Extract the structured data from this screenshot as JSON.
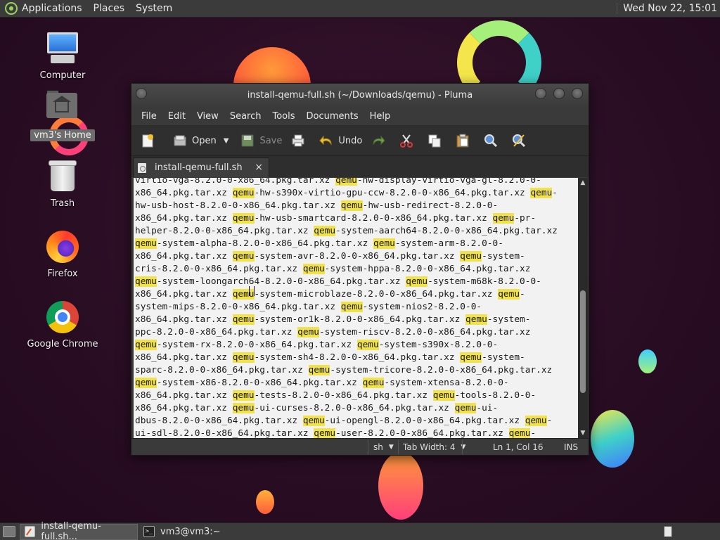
{
  "top_panel": {
    "menus": [
      "Applications",
      "Places",
      "System"
    ],
    "clock": "Wed Nov 22, 15:01"
  },
  "desktop_icons": [
    {
      "label": "Computer"
    },
    {
      "label": "vm3's Home"
    },
    {
      "label": "Trash"
    },
    {
      "label": "Firefox"
    },
    {
      "label": "Google Chrome"
    }
  ],
  "window": {
    "title": "install-qemu-full.sh (~/Downloads/qemu) - Pluma",
    "menus": [
      "File",
      "Edit",
      "View",
      "Search",
      "Tools",
      "Documents",
      "Help"
    ],
    "toolbar": {
      "open": "Open",
      "save": "Save",
      "undo": "Undo"
    },
    "tab": {
      "label": "install-qemu-full.sh",
      "close": "×"
    },
    "editor_lines": [
      [
        "virtio-vga-8.2.0-0-x86_64.pkg.tar.xz ",
        "qemu",
        "-hw-display-virtio-vga-gl-8.2.0-0-"
      ],
      [
        "x86_64.pkg.tar.xz ",
        "qemu",
        "-hw-s390x-virtio-gpu-ccw-8.2.0-0-x86_64.pkg.tar.xz ",
        "qemu",
        "-"
      ],
      [
        "hw-usb-host-8.2.0-0-x86_64.pkg.tar.xz ",
        "qemu",
        "-hw-usb-redirect-8.2.0-0-"
      ],
      [
        "x86_64.pkg.tar.xz ",
        "qemu",
        "-hw-usb-smartcard-8.2.0-0-x86_64.pkg.tar.xz ",
        "qemu",
        "-pr-"
      ],
      [
        "helper-8.2.0-0-x86_64.pkg.tar.xz ",
        "qemu",
        "-system-aarch64-8.2.0-0-x86_64.pkg.tar.xz"
      ],
      [
        "",
        "qemu",
        "-system-alpha-8.2.0-0-x86_64.pkg.tar.xz ",
        "qemu",
        "-system-arm-8.2.0-0-"
      ],
      [
        "x86_64.pkg.tar.xz ",
        "qemu",
        "-system-avr-8.2.0-0-x86_64.pkg.tar.xz ",
        "qemu",
        "-system-"
      ],
      [
        "cris-8.2.0-0-x86_64.pkg.tar.xz ",
        "qemu",
        "-system-hppa-8.2.0-0-x86_64.pkg.tar.xz"
      ],
      [
        "",
        "qemu",
        "-system-loongarch64-8.2.0-0-x86_64.pkg.tar.xz ",
        "qemu",
        "-system-m68k-8.2.0-0-"
      ],
      [
        "x86_64.pkg.tar.xz ",
        "qemu",
        "-system-microblaze-8.2.0-0-x86_64.pkg.tar.xz ",
        "qemu",
        "-"
      ],
      [
        "system-mips-8.2.0-0-x86_64.pkg.tar.xz ",
        "qemu",
        "-system-nios2-8.2.0-0-"
      ],
      [
        "x86_64.pkg.tar.xz ",
        "qemu",
        "-system-or1k-8.2.0-0-x86_64.pkg.tar.xz ",
        "qemu",
        "-system-"
      ],
      [
        "ppc-8.2.0-0-x86_64.pkg.tar.xz ",
        "qemu",
        "-system-riscv-8.2.0-0-x86_64.pkg.tar.xz"
      ],
      [
        "",
        "qemu",
        "-system-rx-8.2.0-0-x86_64.pkg.tar.xz ",
        "qemu",
        "-system-s390x-8.2.0-0-"
      ],
      [
        "x86_64.pkg.tar.xz ",
        "qemu",
        "-system-sh4-8.2.0-0-x86_64.pkg.tar.xz ",
        "qemu",
        "-system-"
      ],
      [
        "sparc-8.2.0-0-x86_64.pkg.tar.xz ",
        "qemu",
        "-system-tricore-8.2.0-0-x86_64.pkg.tar.xz"
      ],
      [
        "",
        "qemu",
        "-system-x86-8.2.0-0-x86_64.pkg.tar.xz ",
        "qemu",
        "-system-xtensa-8.2.0-0-"
      ],
      [
        "x86_64.pkg.tar.xz ",
        "qemu",
        "-tests-8.2.0-0-x86_64.pkg.tar.xz ",
        "qemu",
        "-tools-8.2.0-0-"
      ],
      [
        "x86_64.pkg.tar.xz ",
        "qemu",
        "-ui-curses-8.2.0-0-x86_64.pkg.tar.xz ",
        "qemu",
        "-ui-"
      ],
      [
        "dbus-8.2.0-0-x86_64.pkg.tar.xz ",
        "qemu",
        "-ui-opengl-8.2.0-0-x86_64.pkg.tar.xz ",
        "qemu",
        "-"
      ],
      [
        "ui-sdl-8.2.0-0-x86_64.pkg.tar.xz ",
        "qemu",
        "-user-8.2.0-0-x86_64.pkg.tar.xz ",
        "qemu",
        "-"
      ]
    ],
    "statusbar": {
      "language": "sh",
      "tab_width": "Tab Width:  4",
      "position": "Ln 1, Col 16",
      "mode": "INS"
    }
  },
  "taskbar": {
    "tasks": [
      {
        "label": "install-qemu-full.sh...",
        "active": true
      },
      {
        "label": "vm3@vm3:~",
        "active": false
      }
    ]
  },
  "colors": {
    "highlight": "#f2e24a",
    "editor_bg": "#f2f2f2",
    "panel_bg": "#3b3b3b"
  }
}
